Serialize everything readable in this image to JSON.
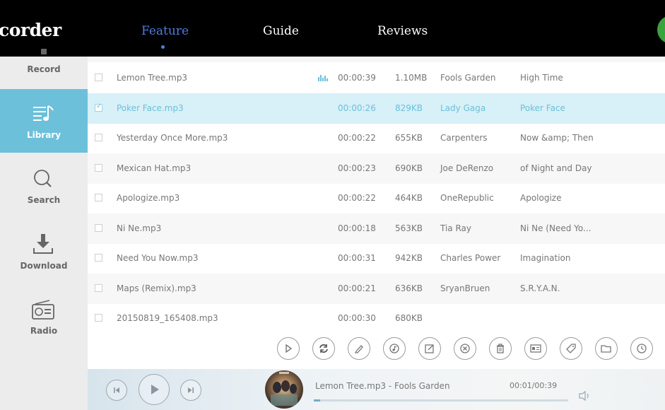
{
  "header": {
    "brand": "corder",
    "nav": [
      {
        "label": "Feature",
        "active": true
      },
      {
        "label": "Guide",
        "active": false
      },
      {
        "label": "Reviews",
        "active": false
      }
    ]
  },
  "sidebar": {
    "items": [
      {
        "label": "Record",
        "icon": "microphone-icon"
      },
      {
        "label": "Library",
        "icon": "library-icon",
        "active": true
      },
      {
        "label": "Search",
        "icon": "search-icon"
      },
      {
        "label": "Download",
        "icon": "download-icon"
      },
      {
        "label": "Radio",
        "icon": "radio-icon"
      }
    ]
  },
  "tracks": [
    {
      "name": "Lemon Tree.mp3",
      "duration": "00:00:39",
      "size": "1.10MB",
      "artist": "Fools Garden",
      "album": "High Time",
      "playing": true
    },
    {
      "name": "Poker Face.mp3",
      "duration": "00:00:26",
      "size": "829KB",
      "artist": "Lady Gaga",
      "album": "Poker Face",
      "selected": true
    },
    {
      "name": "Yesterday Once More.mp3",
      "duration": "00:00:22",
      "size": "655KB",
      "artist": "Carpenters",
      "album": "Now &amp; Then"
    },
    {
      "name": "Mexican Hat.mp3",
      "duration": "00:00:23",
      "size": "690KB",
      "artist": "Joe DeRenzo",
      "album": "of Night and Day"
    },
    {
      "name": "Apologize.mp3",
      "duration": "00:00:22",
      "size": "464KB",
      "artist": "OneRepublic",
      "album": "Apologize"
    },
    {
      "name": "Ni Ne.mp3",
      "duration": "00:00:18",
      "size": "563KB",
      "artist": "Tia Ray",
      "album": "Ni Ne (Need Yo..."
    },
    {
      "name": "Need You Now.mp3",
      "duration": "00:00:31",
      "size": "942KB",
      "artist": "Charles Power",
      "album": "Imagination"
    },
    {
      "name": "Maps (Remix).mp3",
      "duration": "00:00:21",
      "size": "636KB",
      "artist": "SryanBruen",
      "album": "S.R.Y.A.N."
    },
    {
      "name": "20150819_165408.mp3",
      "duration": "00:00:30",
      "size": "680KB",
      "artist": "",
      "album": ""
    }
  ],
  "toolbar": {
    "buttons": [
      "play-icon",
      "convert-icon",
      "edit-icon",
      "music-tag-icon",
      "edit-box-icon",
      "remove-icon",
      "trash-icon",
      "id-card-icon",
      "tag-icon",
      "folder-icon",
      "clock-icon"
    ]
  },
  "player": {
    "now_playing": "Lemon Tree.mp3 - Fools Garden",
    "time": "00:01/00:39",
    "progress": 0.026
  },
  "colors": {
    "accent": "#6cc0da",
    "nav_active": "#4f7ce0",
    "top_bar": "#000000"
  }
}
